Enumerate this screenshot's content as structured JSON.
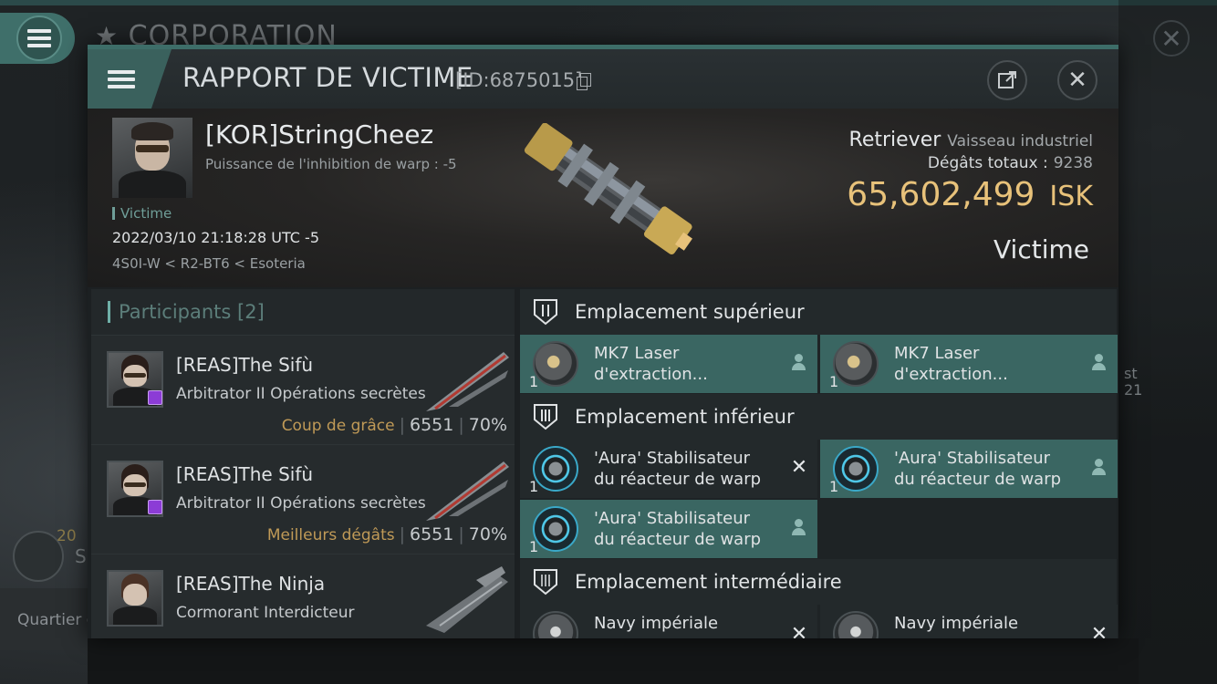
{
  "background": {
    "corp_title": "CORPORATION",
    "left_count": "20",
    "left_label_fragment": "S",
    "quartier_label": "Quartier g",
    "right_fragment_1": "st",
    "right_fragment_2": "21"
  },
  "dialog": {
    "title": "RAPPORT DE VICTIME",
    "id_label": "[ID:6875015]"
  },
  "victim": {
    "name": "[KOR]StringCheez",
    "warp_inhibition": "Puissance de l'inhibition de warp : -5",
    "role": "Victime",
    "datetime": "2022/03/10 21:18:28 UTC -5",
    "location": "4S0I-W < R2-BT6 < Esoteria",
    "ship_name": "Retriever",
    "ship_category": "Vaisseau industriel",
    "damage_label": "Dégâts totaux :",
    "damage_value": "9238",
    "isk_value": "65,602,499",
    "isk_unit": "ISK",
    "outcome": "Victime"
  },
  "participants": {
    "header": "Participants",
    "count": "[2]",
    "rows": [
      {
        "name": "[REAS]The Sifù",
        "ship": "Arbitrator II Opérations secrètes",
        "tag": "Coup de grâce",
        "damage": "6551",
        "percent": "70%"
      },
      {
        "name": "[REAS]The Sifù",
        "ship": "Arbitrator II Opérations secrètes",
        "tag": "Meilleurs dégâts",
        "damage": "6551",
        "percent": "70%"
      },
      {
        "name": "[REAS]The Ninja",
        "ship": "Cormorant Interdicteur",
        "tag": "",
        "damage": "",
        "percent": ""
      }
    ]
  },
  "fittings": {
    "high": {
      "label": "Emplacement supérieur",
      "modules": [
        {
          "line1": "MK7 Laser",
          "line2": "d'extraction...",
          "qty": "1",
          "state": "dropped"
        },
        {
          "line1": "MK7 Laser",
          "line2": "d'extraction...",
          "qty": "1",
          "state": "dropped"
        }
      ]
    },
    "low": {
      "label": "Emplacement inférieur",
      "modules": [
        {
          "line1": "'Aura' Stabilisateur",
          "line2": "du réacteur de warp",
          "qty": "1",
          "state": "destroyed"
        },
        {
          "line1": "'Aura' Stabilisateur",
          "line2": "du réacteur de warp",
          "qty": "1",
          "state": "dropped"
        },
        {
          "line1": "'Aura' Stabilisateur",
          "line2": "du réacteur de warp",
          "qty": "1",
          "state": "dropped"
        }
      ]
    },
    "mid": {
      "label": "Emplacement intermédiaire",
      "modules": [
        {
          "line1": "Navy impériale",
          "line2": "",
          "qty": "",
          "state": "destroyed"
        },
        {
          "line1": "Navy impériale",
          "line2": "",
          "qty": "",
          "state": "destroyed"
        }
      ]
    }
  },
  "colors": {
    "accent_teal": "#3a6662",
    "isk_gold": "#e8c27a",
    "tag_gold": "#c09a57",
    "corp_badge": "#8c3cd6"
  }
}
